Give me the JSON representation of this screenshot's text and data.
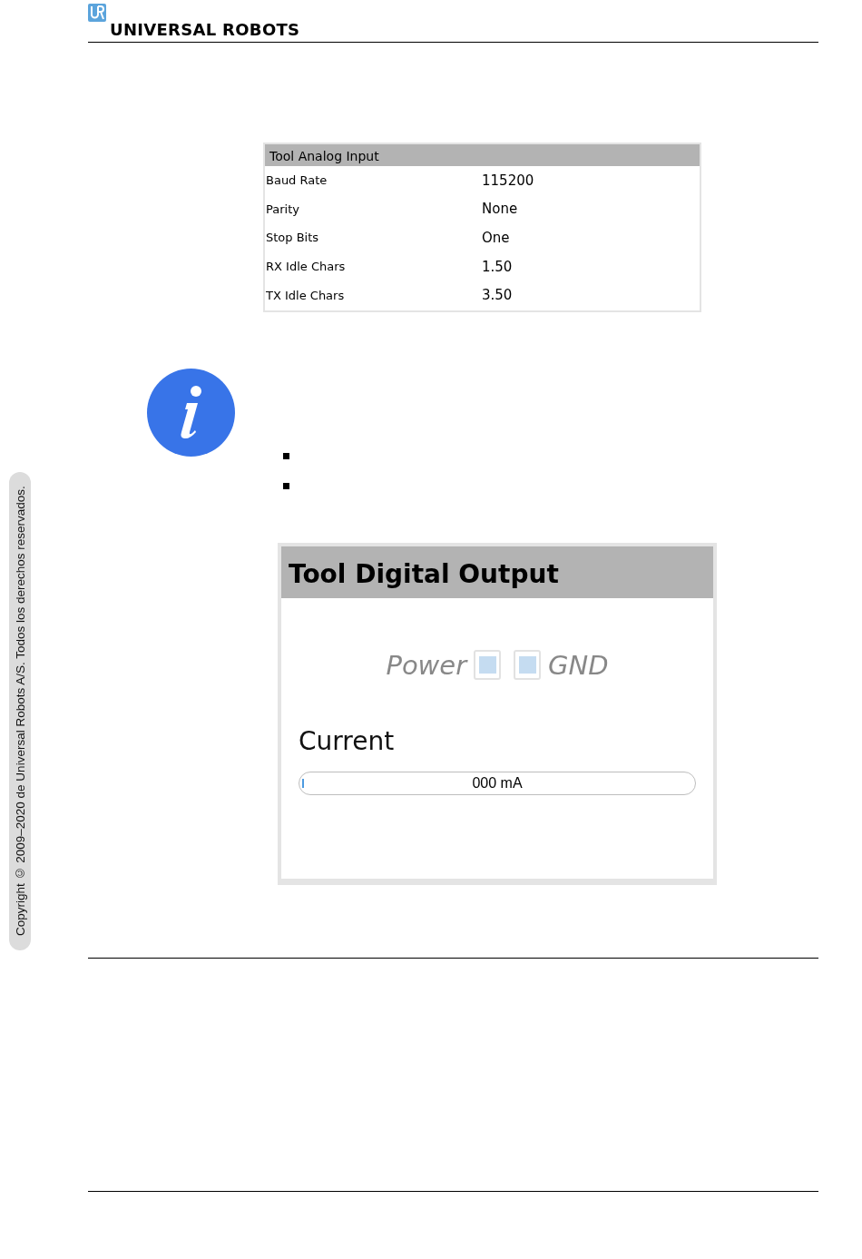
{
  "header": {
    "brand": "UNIVERSAL ROBOTS"
  },
  "analog_panel": {
    "title": "Tool Analog Input",
    "rows": [
      {
        "label": "Baud Rate",
        "value": "115200"
      },
      {
        "label": "Parity",
        "value": "None"
      },
      {
        "label": "Stop Bits",
        "value": "One"
      },
      {
        "label": "RX Idle Chars",
        "value": "1.50"
      },
      {
        "label": "TX Idle Chars",
        "value": "3.50"
      }
    ]
  },
  "note": {
    "bullets": [
      {
        "kind": "square"
      },
      {
        "kind": "square"
      }
    ]
  },
  "digital_panel": {
    "title": "Tool Digital Output",
    "options": [
      {
        "label": "Power",
        "checked": false,
        "disabled": true,
        "kind": "label_left"
      },
      {
        "label": "GND",
        "checked": false,
        "disabled": true,
        "kind": "label_right"
      }
    ],
    "current": {
      "label": "Current",
      "reading": "000 mA",
      "level": 0.005
    }
  },
  "side_note": "Copyright © 2009–2020 de Universal Robots A/S. Todos los derechos reservados."
}
